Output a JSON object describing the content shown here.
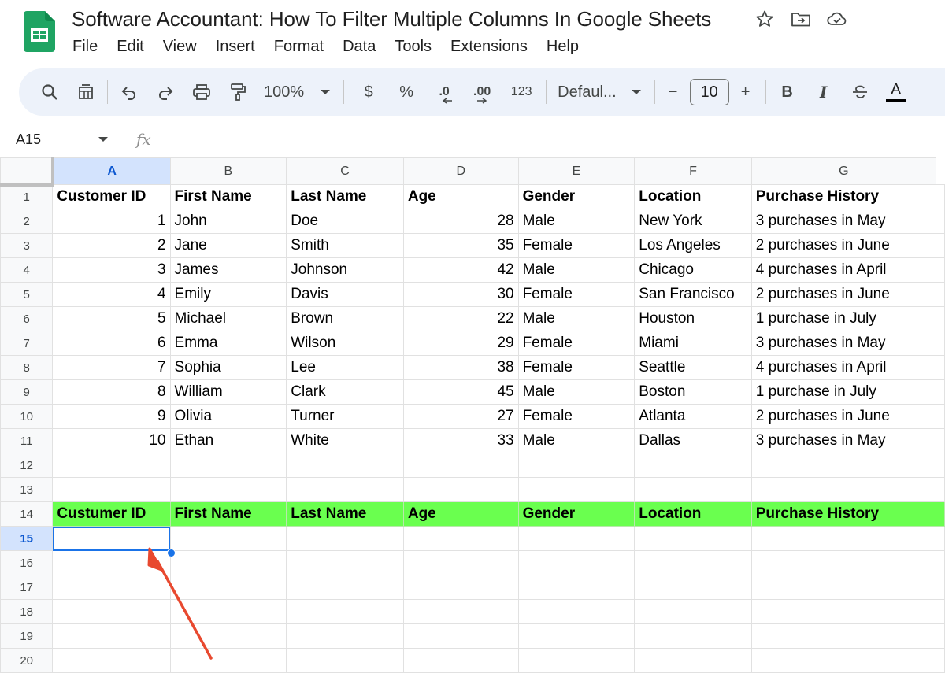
{
  "app": {
    "title": "Software Accountant: How To Filter Multiple Columns In Google Sheets",
    "menu": [
      "File",
      "Edit",
      "View",
      "Insert",
      "Format",
      "Data",
      "Tools",
      "Extensions",
      "Help"
    ]
  },
  "toolbar": {
    "zoom": "100%",
    "currency": "$",
    "percent": "%",
    "decrease_decimal": ".0",
    "increase_decimal": ".00",
    "number_format": "123",
    "font": "Defaul...",
    "font_size": "10",
    "minus": "−",
    "plus": "+",
    "bold": "B",
    "italic": "I",
    "text_color": "A"
  },
  "formula_bar": {
    "cell_ref": "A15",
    "fx": "fx",
    "value": ""
  },
  "sheet": {
    "active_cell": "A15",
    "columns": [
      "A",
      "B",
      "C",
      "D",
      "E",
      "F",
      "G"
    ],
    "rows": [
      [
        "Customer ID",
        "First Name",
        "Last Name",
        "Age",
        "Gender",
        "Location",
        "Purchase History"
      ],
      [
        "1",
        "John",
        "Doe",
        "28",
        "Male",
        "New York",
        "3 purchases in May"
      ],
      [
        "2",
        "Jane",
        "Smith",
        "35",
        "Female",
        "Los Angeles",
        "2 purchases in June"
      ],
      [
        "3",
        "James",
        "Johnson",
        "42",
        "Male",
        "Chicago",
        "4 purchases in April"
      ],
      [
        "4",
        "Emily",
        "Davis",
        "30",
        "Female",
        "San Francisco",
        "2 purchases in June"
      ],
      [
        "5",
        "Michael",
        "Brown",
        "22",
        "Male",
        "Houston",
        "1 purchase in July"
      ],
      [
        "6",
        "Emma",
        "Wilson",
        "29",
        "Female",
        "Miami",
        "3 purchases in May"
      ],
      [
        "7",
        "Sophia",
        "Lee",
        "38",
        "Female",
        "Seattle",
        "4 purchases in April"
      ],
      [
        "8",
        "William",
        "Clark",
        "45",
        "Male",
        "Boston",
        "1 purchase in July"
      ],
      [
        "9",
        "Olivia",
        "Turner",
        "27",
        "Female",
        "Atlanta",
        "2 purchases in June"
      ],
      [
        "10",
        "Ethan",
        "White",
        "33",
        "Male",
        "Dallas",
        "3 purchases in May"
      ],
      [
        "",
        "",
        "",
        "",
        "",
        "",
        ""
      ],
      [
        "",
        "",
        "",
        "",
        "",
        "",
        ""
      ],
      [
        "Custumer ID",
        "First Name",
        "Last Name",
        "Age",
        "Gender",
        "Location",
        "Purchase History"
      ],
      [
        "",
        "",
        "",
        "",
        "",
        "",
        ""
      ],
      [
        "",
        "",
        "",
        "",
        "",
        "",
        ""
      ],
      [
        "",
        "",
        "",
        "",
        "",
        "",
        ""
      ],
      [
        "",
        "",
        "",
        "",
        "",
        "",
        ""
      ],
      [
        "",
        "",
        "",
        "",
        "",
        "",
        ""
      ],
      [
        "",
        "",
        "",
        "",
        "",
        "",
        ""
      ]
    ]
  },
  "colors": {
    "green_header_fill": "#6aff4f",
    "selection": "#1a73e8",
    "annotation_arrow": "#e8492f",
    "toolbar_bg": "#edf2fa"
  }
}
